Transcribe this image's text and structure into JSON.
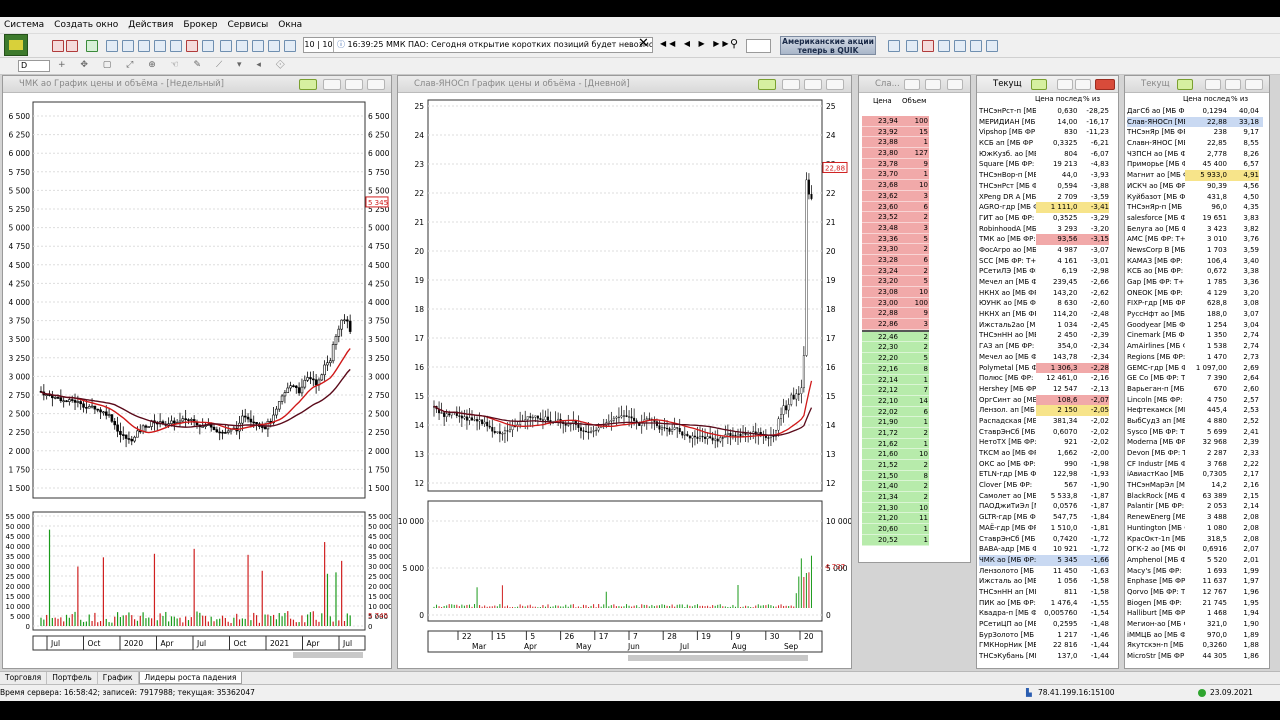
{
  "menu": [
    "Система",
    "Создать окно",
    "Действия",
    "Брокер",
    "Сервисы",
    "Окна"
  ],
  "toolbar": {
    "ticker_count": "10 | 10",
    "ticker_text": "16:39:25  ММК ПАО: Сегодня открытие коротких позиций будет невозможно. (",
    "ad_text_line1": "Американские акции",
    "ad_text_line2": "теперь в QUIK"
  },
  "toolbar2_first": "D",
  "chart1": {
    "title": "ЧМК ао График цены и объёма - [Недельный]",
    "price_label": "5 345",
    "vol_label": "5 745",
    "y_ticks": [
      "6 500",
      "6 250",
      "6 000",
      "5 750",
      "5 500",
      "5 250",
      "5 000",
      "4 750",
      "4 500",
      "4 250",
      "4 000",
      "3 750",
      "3 500",
      "3 250",
      "3 000",
      "2 750",
      "2 500",
      "2 250",
      "2 000",
      "1 750",
      "1 500"
    ],
    "vol_ticks": [
      "55 000",
      "50 000",
      "45 000",
      "40 000",
      "35 000",
      "30 000",
      "25 000",
      "20 000",
      "15 000",
      "10 000",
      "5 000",
      "0"
    ],
    "x_labels": [
      "Jul",
      "Oct",
      "2020",
      "Apr",
      "Jul",
      "Oct",
      "2021",
      "Apr",
      "Jul"
    ]
  },
  "chart2": {
    "title": "Слав-ЯНОСп График цены и объёма - [Дневной]",
    "price_label": "22,88",
    "vol_label": "4 737",
    "y_ticks": [
      "25",
      "24",
      "23",
      "22",
      "21",
      "20",
      "19",
      "18",
      "17",
      "16",
      "15",
      "14",
      "13",
      "12"
    ],
    "vol_ticks": [
      "10 000",
      "5 000",
      "0"
    ],
    "x_numbers": [
      "22",
      "15",
      "5",
      "26",
      "17",
      "7",
      "28",
      "19",
      "9",
      "30",
      "20"
    ],
    "x_months": [
      "Mar",
      "Apr",
      "May",
      "Jun",
      "Jul",
      "Aug",
      "Sep"
    ]
  },
  "orderbook": {
    "title": "Сла...",
    "col_price": "Цена",
    "col_volume": "Объем",
    "asks": [
      [
        "23,94",
        "100"
      ],
      [
        "23,92",
        "15"
      ],
      [
        "23,88",
        "1"
      ],
      [
        "23,80",
        "127"
      ],
      [
        "23,78",
        "9"
      ],
      [
        "23,70",
        "1"
      ],
      [
        "23,68",
        "10"
      ],
      [
        "23,62",
        "3"
      ],
      [
        "23,60",
        "6"
      ],
      [
        "23,52",
        "2"
      ],
      [
        "23,48",
        "3"
      ],
      [
        "23,36",
        "5"
      ],
      [
        "23,30",
        "2"
      ],
      [
        "23,28",
        "6"
      ],
      [
        "23,24",
        "2"
      ],
      [
        "23,20",
        "5"
      ],
      [
        "23,08",
        "10"
      ],
      [
        "23,00",
        "100"
      ],
      [
        "22,88",
        "9"
      ],
      [
        "22,86",
        "3"
      ]
    ],
    "bids": [
      [
        "22,46",
        "2"
      ],
      [
        "22,30",
        "2"
      ],
      [
        "22,20",
        "5"
      ],
      [
        "22,16",
        "8"
      ],
      [
        "22,14",
        "1"
      ],
      [
        "22,12",
        "7"
      ],
      [
        "22,10",
        "14"
      ],
      [
        "22,02",
        "6"
      ],
      [
        "21,90",
        "1"
      ],
      [
        "21,72",
        "2"
      ],
      [
        "21,62",
        "1"
      ],
      [
        "21,60",
        "10"
      ],
      [
        "21,52",
        "2"
      ],
      [
        "21,50",
        "8"
      ],
      [
        "21,40",
        "2"
      ],
      [
        "21,34",
        "2"
      ],
      [
        "21,30",
        "10"
      ],
      [
        "21,20",
        "11"
      ],
      [
        "20,60",
        "1"
      ],
      [
        "20,52",
        "1"
      ]
    ]
  },
  "table1": {
    "title": "Текущ",
    "headers": [
      "",
      "Цена послед",
      "% из"
    ],
    "rows": [
      [
        "ТНСэнРст-п [МБ",
        "0,630",
        "-28,25",
        "n"
      ],
      [
        "МЕРИДИАН [МБ",
        "14,00",
        "-16,17",
        "n"
      ],
      [
        "Vipshop [МБ ФР",
        "830",
        "-11,23",
        "n"
      ],
      [
        "КСБ ап [МБ ФР",
        "0,3325",
        "-6,21",
        "n"
      ],
      [
        "ЮжКузб. ао [МБ",
        "804",
        "-6,07",
        "n"
      ],
      [
        "Square [МБ ФР:",
        "19 213",
        "-4,83",
        "n"
      ],
      [
        "ТНСэнВор-п [МБ",
        "44,0",
        "-3,93",
        "n"
      ],
      [
        "ТНСэнРст [МБ Ф",
        "0,594",
        "-3,88",
        "n"
      ],
      [
        "XPeng DR A [МБ",
        "2 709",
        "-3,59",
        "n"
      ],
      [
        "AGRO-гдр [МБ Ф",
        "1 111,0",
        "-3,41",
        "y"
      ],
      [
        "ГИТ ао [МБ ФР:",
        "0,3525",
        "-3,29",
        "n"
      ],
      [
        "RobinhoodA [МБ",
        "3 293",
        "-3,20",
        "n"
      ],
      [
        "ТМК ао [МБ ФР:",
        "93,56",
        "-3,15",
        "r"
      ],
      [
        "ФосАгро ао [МБ",
        "4 987",
        "-3,07",
        "n"
      ],
      [
        "SCC [МБ ФР: Т+",
        "4 161",
        "-3,01",
        "n"
      ],
      [
        "РСетиЛЭ [МБ ФР",
        "6,19",
        "-2,98",
        "n"
      ],
      [
        "Мечел ап [МБ Ф",
        "239,45",
        "-2,66",
        "n"
      ],
      [
        "НКНХ ао [МБ ФР",
        "143,20",
        "-2,62",
        "n"
      ],
      [
        "ЮУНК ао [МБ Ф",
        "8 630",
        "-2,60",
        "n"
      ],
      [
        "НКНХ ап [МБ ФР",
        "114,20",
        "-2,48",
        "n"
      ],
      [
        "Ижсталь2ао [МБ",
        "1 034",
        "-2,45",
        "n"
      ],
      [
        "ТНСэнНН ао [МБ",
        "2 450",
        "-2,39",
        "n"
      ],
      [
        "ГАЗ ап [МБ ФР:",
        "354,0",
        "-2,34",
        "n"
      ],
      [
        "Мечел ао [МБ Ф",
        "143,78",
        "-2,34",
        "n"
      ],
      [
        "Polymetal [МБ Ф",
        "1 306,3",
        "-2,28",
        "r"
      ],
      [
        "Полюс [МБ ФР:",
        "12 461,0",
        "-2,16",
        "n"
      ],
      [
        "Hershey [МБ ФР",
        "12 547",
        "-2,13",
        "n"
      ],
      [
        "ОргСинт ао [МБ",
        "108,6",
        "-2,07",
        "r"
      ],
      [
        "Лензол. ап [МБ Ф",
        "2 150",
        "-2,05",
        "y"
      ],
      [
        "Распадская [МБ",
        "381,34",
        "-2,02",
        "n"
      ],
      [
        "СтаврЭнСб [МБ",
        "0,6070",
        "-2,02",
        "n"
      ],
      [
        "НетоТХ [МБ ФР:",
        "921",
        "-2,02",
        "n"
      ],
      [
        "ТКСМ ао [МБ ФР",
        "1,662",
        "-2,00",
        "n"
      ],
      [
        "ОКС ао [МБ ФР:",
        "990",
        "-1,98",
        "n"
      ],
      [
        "ETLN-гдр [МБ ФР",
        "122,98",
        "-1,93",
        "n"
      ],
      [
        "Clover [МБ ФР:",
        "567",
        "-1,90",
        "n"
      ],
      [
        "Самолет ао [МБ",
        "5 533,8",
        "-1,87",
        "n"
      ],
      [
        "ПАОДжиТиЭл [МБ",
        "0,0576",
        "-1,87",
        "n"
      ],
      [
        "GLTR-гдр [МБ ФР",
        "547,75",
        "-1,84",
        "n"
      ],
      [
        "МАЁ-гдр [МБ ФР",
        "1 510,0",
        "-1,81",
        "n"
      ],
      [
        "СтаврЭнСб [МБ",
        "0,7420",
        "-1,72",
        "n"
      ],
      [
        "ВАВА-адр [МБ ФР",
        "10 921",
        "-1,72",
        "n"
      ],
      [
        "ЧМК ао [МБ ФР:",
        "5 345",
        "-1,66",
        "s"
      ],
      [
        "Лензолото [МБ Ф",
        "11 450",
        "-1,63",
        "n"
      ],
      [
        "Ижсталь ао [МБ",
        "1 056",
        "-1,58",
        "n"
      ],
      [
        "ТНСэнНН ап [МБ",
        "811",
        "-1,58",
        "n"
      ],
      [
        "ПИК ао [МБ ФР:",
        "1 476,4",
        "-1,55",
        "n"
      ],
      [
        "Квадра-п [МБ Ф",
        "0,005760",
        "-1,54",
        "n"
      ],
      [
        "РСетиЦП ао [МБ",
        "0,2595",
        "-1,48",
        "n"
      ],
      [
        "БурЗолото [МБ",
        "1 217",
        "-1,46",
        "n"
      ],
      [
        "ГМКНорНик [МБ",
        "22 816",
        "-1,44",
        "n"
      ],
      [
        "ТНСэКубань [МБ",
        "137,0",
        "-1,44",
        "n"
      ]
    ]
  },
  "table2": {
    "title": "Текущ",
    "headers": [
      "",
      "Цена послед",
      "% из"
    ],
    "rows": [
      [
        "ДагСб ао [МБ ФР",
        "0,1294",
        "40,04",
        "n"
      ],
      [
        "Слав-ЯНОСп [МБ",
        "22,88",
        "33,18",
        "s"
      ],
      [
        "ТНСэнЯр [МБ ФР",
        "238",
        "9,17",
        "n"
      ],
      [
        "Славн-ЯНОС [МБ",
        "22,85",
        "8,55",
        "n"
      ],
      [
        "ЧЗПСН ао [МБ Ф",
        "2,778",
        "8,26",
        "n"
      ],
      [
        "Приморье [МБ ФР",
        "45 400",
        "6,57",
        "n"
      ],
      [
        "Магнит ао [МБ Ф",
        "5 933,0",
        "4,91",
        "y"
      ],
      [
        "ИСКЧ ао [МБ ФР",
        "90,39",
        "4,56",
        "n"
      ],
      [
        "Куйбазот [МБ ФР",
        "431,8",
        "4,50",
        "n"
      ],
      [
        "ТНСэнЯр-п [МБ",
        "96,0",
        "4,35",
        "n"
      ],
      [
        "salesforce [МБ Ф",
        "19 651",
        "3,83",
        "n"
      ],
      [
        "Белуга ао [МБ ФР",
        "3 423",
        "3,82",
        "n"
      ],
      [
        "AMC [МБ ФР: Т+",
        "3 010",
        "3,76",
        "n"
      ],
      [
        "NewsCorp B [МБ",
        "1 703",
        "3,59",
        "n"
      ],
      [
        "КАМАЗ [МБ ФР:",
        "106,4",
        "3,40",
        "n"
      ],
      [
        "КСБ ао [МБ ФР:",
        "0,672",
        "3,38",
        "n"
      ],
      [
        "Gap [МБ ФР: Т+",
        "1 785",
        "3,36",
        "n"
      ],
      [
        "ONEOK [МБ ФР:",
        "4 129",
        "3,20",
        "n"
      ],
      [
        "FIXP-гдр [МБ ФР",
        "628,8",
        "3,08",
        "n"
      ],
      [
        "РуссНфт ао [МБ",
        "188,0",
        "3,07",
        "n"
      ],
      [
        "Goodyear [МБ ФР",
        "1 254",
        "3,04",
        "n"
      ],
      [
        "Cinemark [МБ ФР",
        "1 350",
        "2,74",
        "n"
      ],
      [
        "AmAirlines [МБ Ф",
        "1 538",
        "2,74",
        "n"
      ],
      [
        "Regions [МБ ФР:",
        "1 470",
        "2,73",
        "n"
      ],
      [
        "GEMC-гдр [МБ ФР",
        "1 097,00",
        "2,69",
        "n"
      ],
      [
        "GE Co [МБ ФР: Т",
        "7 390",
        "2,64",
        "n"
      ],
      [
        "Варьеган-п [МБ",
        "670",
        "2,60",
        "n"
      ],
      [
        "Lincoln [МБ ФР:",
        "4 750",
        "2,57",
        "n"
      ],
      [
        "Нефтекамск [МБ",
        "445,4",
        "2,53",
        "n"
      ],
      [
        "ВыбСуд3 ап [МБ",
        "4 880",
        "2,52",
        "n"
      ],
      [
        "Sysco [МБ ФР: Т",
        "5 699",
        "2,41",
        "n"
      ],
      [
        "Moderna [МБ ФР",
        "32 968",
        "2,39",
        "n"
      ],
      [
        "Devon [МБ ФР: Т",
        "2 287",
        "2,33",
        "n"
      ],
      [
        "CF Industr [МБ ФР",
        "3 768",
        "2,22",
        "n"
      ],
      [
        "iАвиастКао [МБ",
        "0,7305",
        "2,17",
        "n"
      ],
      [
        "ТНСэнМарЭл [МБ",
        "14,2",
        "2,16",
        "n"
      ],
      [
        "BlackRock [МБ ФР",
        "63 389",
        "2,15",
        "n"
      ],
      [
        "Palantir [МБ ФР:",
        "2 053",
        "2,14",
        "n"
      ],
      [
        "RenewEnerg [МБ",
        "3 488",
        "2,08",
        "n"
      ],
      [
        "Huntington [МБ Ф",
        "1 080",
        "2,08",
        "n"
      ],
      [
        "КрасОкт-1п [МБ",
        "318,5",
        "2,08",
        "n"
      ],
      [
        "ОГК-2 ао [МБ ФР",
        "0,6916",
        "2,07",
        "n"
      ],
      [
        "Amphenol [МБ ФР",
        "5 520",
        "2,01",
        "n"
      ],
      [
        "Macy's [МБ ФР:",
        "1 693",
        "1,99",
        "n"
      ],
      [
        "Enphase [МБ ФР:",
        "11 637",
        "1,97",
        "n"
      ],
      [
        "Qorvo [МБ ФР: Т",
        "12 767",
        "1,96",
        "n"
      ],
      [
        "Biogen [МБ ФР:",
        "21 745",
        "1,95",
        "n"
      ],
      [
        "Halliburt [МБ ФР",
        "1 468",
        "1,94",
        "n"
      ],
      [
        "Мегион-ао [МБ Ф",
        "321,0",
        "1,90",
        "n"
      ],
      [
        "iММЦБ ао [МБ ФР",
        "970,0",
        "1,89",
        "n"
      ],
      [
        "Якутскэн-п [МБ",
        "0,3260",
        "1,88",
        "n"
      ],
      [
        "MicroStr [МБ ФР",
        "44 305",
        "1,86",
        "n"
      ]
    ]
  },
  "tabs": [
    "Торговля",
    "Портфель",
    "График",
    "Лидеры роста падения"
  ],
  "status": {
    "server_time": "Время сервера: 16:58:42; записей: 7917988; текущая: 35362047",
    "connection": "78.41.199.16:15100",
    "date": "23.09.2021"
  }
}
